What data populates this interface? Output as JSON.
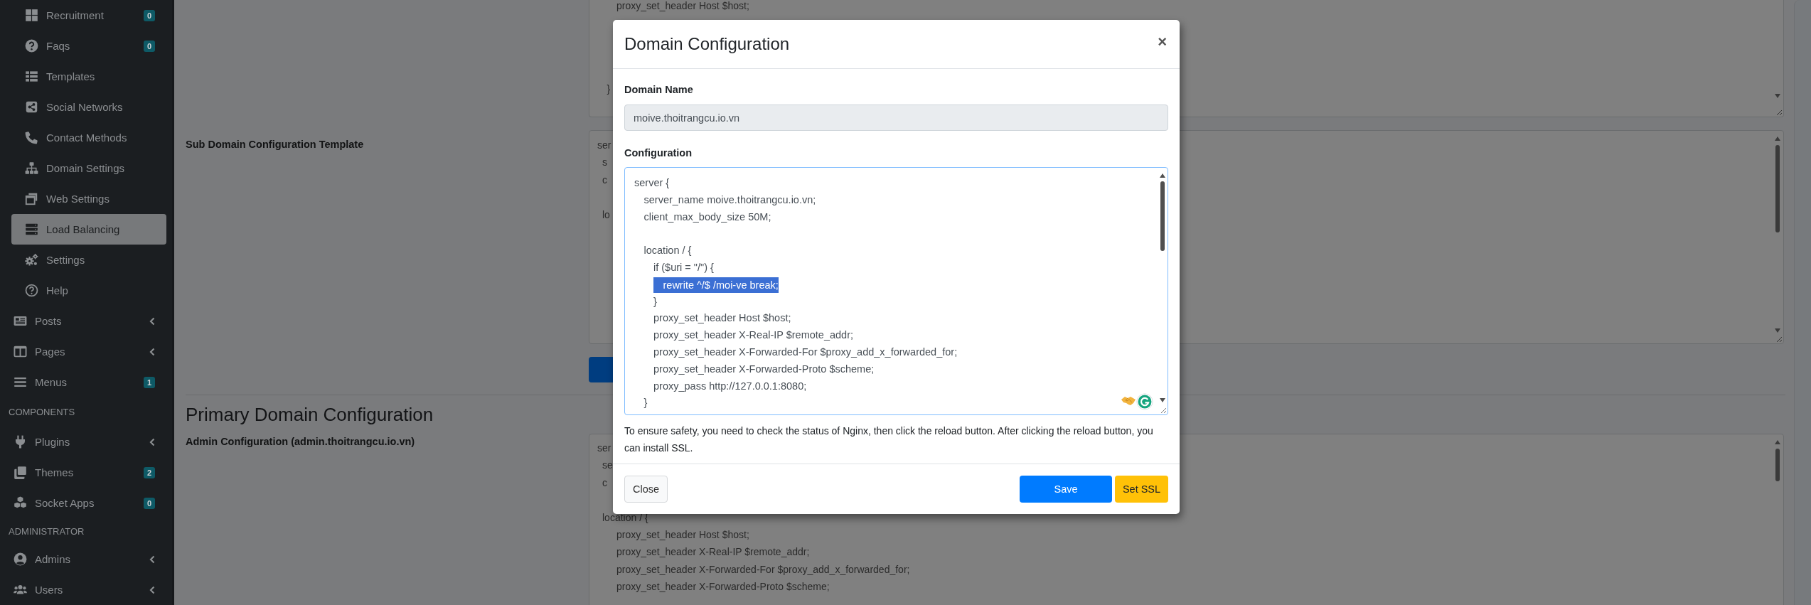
{
  "sidebar": {
    "submenu_items": [
      {
        "label": "Recruitment",
        "badge": "0",
        "selected": false
      },
      {
        "label": "Faqs",
        "badge": "0",
        "selected": false
      },
      {
        "label": "Templates",
        "selected": false
      },
      {
        "label": "Social Networks",
        "selected": false
      },
      {
        "label": "Contact Methods",
        "selected": false
      },
      {
        "label": "Domain Settings",
        "selected": false
      },
      {
        "label": "Web Settings",
        "selected": false
      },
      {
        "label": "Load Balancing",
        "selected": true
      },
      {
        "label": "Settings",
        "selected": false
      },
      {
        "label": "Help",
        "selected": false
      }
    ],
    "items": [
      {
        "label": "Posts",
        "has_submenu": true,
        "selected": false
      },
      {
        "label": "Pages",
        "has_submenu": true,
        "selected": false
      },
      {
        "label": "Menus",
        "badge": "1",
        "has_submenu": false,
        "selected": false
      }
    ],
    "sections": [
      {
        "heading": "COMPONENTS",
        "items": [
          {
            "label": "Plugins",
            "has_submenu": true,
            "selected": false
          },
          {
            "label": "Themes",
            "badge": "2",
            "has_submenu": false,
            "selected": false
          },
          {
            "label": "Socket Apps",
            "badge": "0",
            "has_submenu": false,
            "selected": false
          }
        ]
      },
      {
        "heading": "ADMINISTRATOR",
        "items": [
          {
            "label": "Admins",
            "has_submenu": true,
            "selected": false
          },
          {
            "label": "Users",
            "has_submenu": true,
            "selected": false
          }
        ]
      }
    ]
  },
  "main": {
    "top_textarea": {
      "top_line": "proxy_set_header Host $host;",
      "closing_line": "}"
    },
    "sub_domain": {
      "label": "Sub Domain Configuration Template",
      "lines": [
        {
          "text": "ser",
          "children": [
            {
              "text": "s"
            },
            {
              "text": "c"
            },
            {
              "kind": "blank"
            },
            {
              "text": "lo"
            }
          ]
        }
      ]
    },
    "primary_heading": "Primary Domain Configuration",
    "admin": {
      "label": "Admin Configuration (admin.thoitrangcu.io.vn)",
      "lines": [
        {
          "text": "ser",
          "children": [
            {
              "text": "se"
            },
            {
              "text": "c"
            },
            {
              "kind": "blank"
            },
            {
              "text": "location / {",
              "children": [
                {
                  "text": "proxy_set_header Host $host;"
                },
                {
                  "text": "proxy_set_header X-Real-IP $remote_addr;"
                },
                {
                  "text": "proxy_set_header X-Forwarded-For $proxy_add_x_forwarded_for;"
                },
                {
                  "text": "proxy_set_header X-Forwarded-Proto $scheme;"
                }
              ]
            }
          ]
        }
      ]
    }
  },
  "modal": {
    "title": "Domain Configuration",
    "close_label": "×",
    "domain_label": "Domain Name",
    "domain_value": "moive.thoitrangcu.io.vn",
    "config_label": "Configuration",
    "config_lines": [
      {
        "text": "server {",
        "selected": false,
        "children": [
          {
            "text": "server_name moive.thoitrangcu.io.vn;",
            "selected": false
          },
          {
            "text": "client_max_body_size 50M;",
            "selected": false
          },
          {
            "kind": "blank"
          },
          {
            "text": "location / {",
            "selected": false,
            "children": [
              {
                "text": "if ($uri = \"/\") {",
                "selected": false,
                "children": [
                  {
                    "text": "rewrite ^/$ /moi-ve break;",
                    "selected": true
                  }
                ]
              },
              {
                "text": "}",
                "selected": false
              },
              {
                "text": "proxy_set_header Host $host;",
                "selected": false
              },
              {
                "text": "proxy_set_header X-Real-IP $remote_addr;",
                "selected": false
              },
              {
                "text": "proxy_set_header X-Forwarded-For $proxy_add_x_forwarded_for;",
                "selected": false
              },
              {
                "text": "proxy_set_header X-Forwarded-Proto $scheme;",
                "selected": false
              },
              {
                "text": "proxy_pass http://127.0.0.1:8080;",
                "selected": false
              }
            ]
          },
          {
            "text": "}",
            "selected": false
          }
        ]
      }
    ],
    "help_text": "To ensure safety, you need to check the status of Nginx, then click the reload button. After clicking the reload button, you can install SSL.",
    "buttons": [
      {
        "label": "Close",
        "kind": "secondary"
      },
      {
        "label": "Save",
        "kind": "primary"
      },
      {
        "label": "Set SSL",
        "kind": "warning"
      }
    ]
  }
}
